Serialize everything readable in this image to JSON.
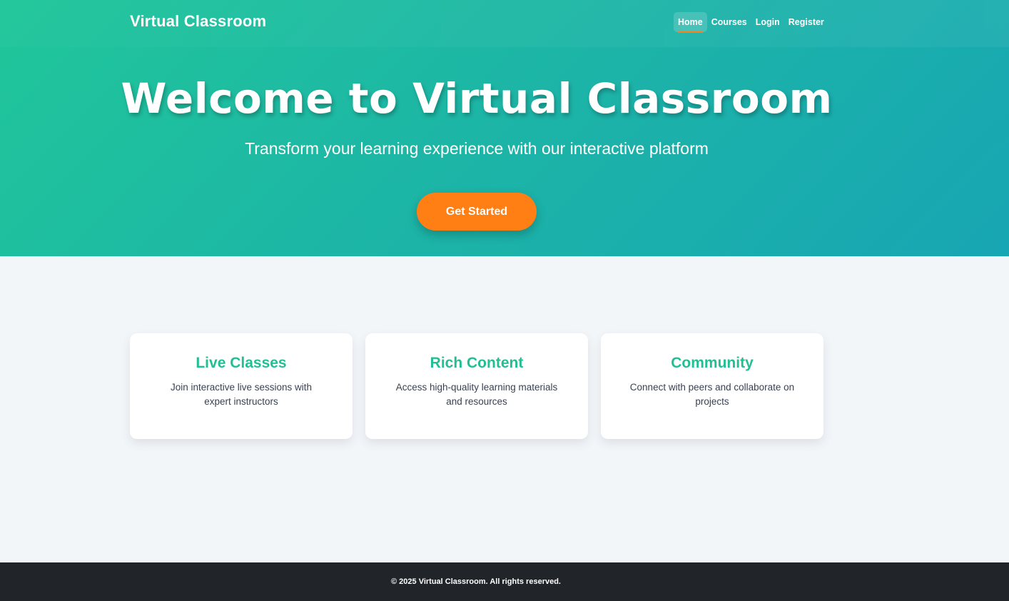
{
  "header": {
    "brand": "Virtual Classroom",
    "nav": [
      {
        "label": "Home",
        "active": true
      },
      {
        "label": "Courses",
        "active": false
      },
      {
        "label": "Login",
        "active": false
      },
      {
        "label": "Register",
        "active": false
      }
    ]
  },
  "hero": {
    "title": "Welcome to Virtual Classroom",
    "subtitle": "Transform your learning experience with our interactive platform",
    "cta_label": "Get Started"
  },
  "features": [
    {
      "title": "Live Classes",
      "description": "Join interactive live sessions with expert instructors"
    },
    {
      "title": "Rich Content",
      "description": "Access high-quality learning materials and resources"
    },
    {
      "title": "Community",
      "description": "Connect with peers and collaborate on projects"
    }
  ],
  "footer": {
    "text": "© 2025 Virtual Classroom. All rights reserved."
  },
  "colors": {
    "hero_gradient_start": "#20c69a",
    "hero_gradient_end": "#17a6b3",
    "accent": "#ff7f15",
    "feature_title": "#22bf94",
    "footer_bg": "#212429"
  }
}
